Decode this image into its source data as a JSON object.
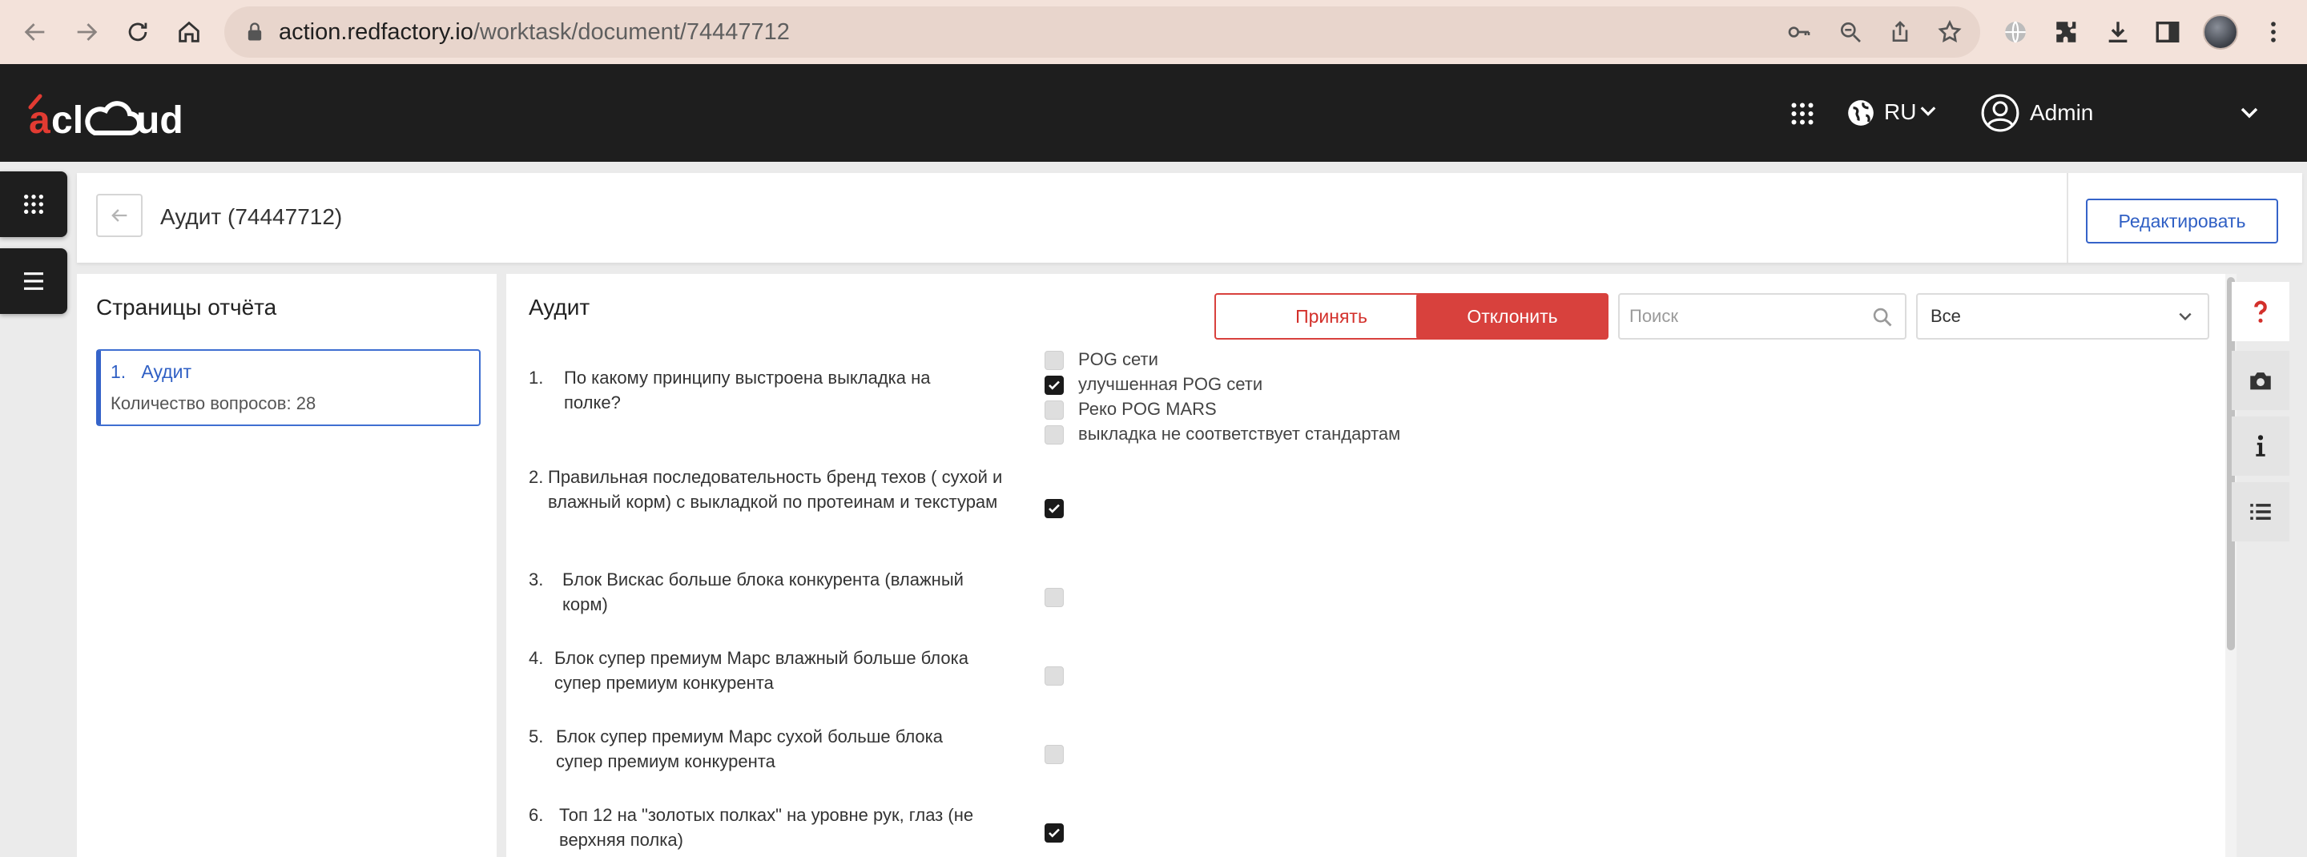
{
  "browser": {
    "url_host": "action.redfactory.io",
    "url_path": "/worktask/document/74447712"
  },
  "header": {
    "logo_text": "acloud",
    "language": "RU",
    "user_name": "Admin"
  },
  "title_bar": {
    "title": "Аудит (74447712)",
    "edit_label": "Редактировать"
  },
  "pages_panel": {
    "title": "Страницы отчёта",
    "items": [
      {
        "num": "1.",
        "name": "Аудит",
        "count_label": "Количество вопросов: 28"
      }
    ]
  },
  "main": {
    "title": "Аудит",
    "accept_label": "Принять",
    "reject_label": "Отклонить",
    "search_placeholder": "Поиск",
    "filter_value": "Все",
    "questions": [
      {
        "num": "1.",
        "text": "По какому принципу выстроена выкладка на полке?",
        "options": [
          {
            "label": "POG сети",
            "checked": false
          },
          {
            "label": "улучшенная POG сети",
            "checked": true
          },
          {
            "label": "Реко POG MARS",
            "checked": false
          },
          {
            "label": "выкладка не соответствует стандартам",
            "checked": false
          }
        ]
      },
      {
        "num": "2.",
        "text": "Правильная последовательность бренд техов ( сухой и влажный корм) с выкладкой по протеинам и текстурам",
        "checked": true
      },
      {
        "num": "3.",
        "text": "Блок Вискас больше блока конкурента (влажный корм)",
        "checked": false
      },
      {
        "num": "4.",
        "text": "Блок супер премиум Марс влажный больше блока супер премиум конкурента",
        "checked": false
      },
      {
        "num": "5.",
        "text": "Блок супер премиум Марс сухой больше блока супер премиум конкурента",
        "checked": false
      },
      {
        "num": "6.",
        "text": "Топ 12 на \"золотых полках\" на уровне рук, глаз (не верхняя полка)",
        "checked": true
      }
    ]
  },
  "colors": {
    "accent_blue": "#3563c9",
    "accent_red": "#d8413d",
    "header_bg": "#1e1e1e",
    "chrome_bg": "#f3e2da"
  }
}
